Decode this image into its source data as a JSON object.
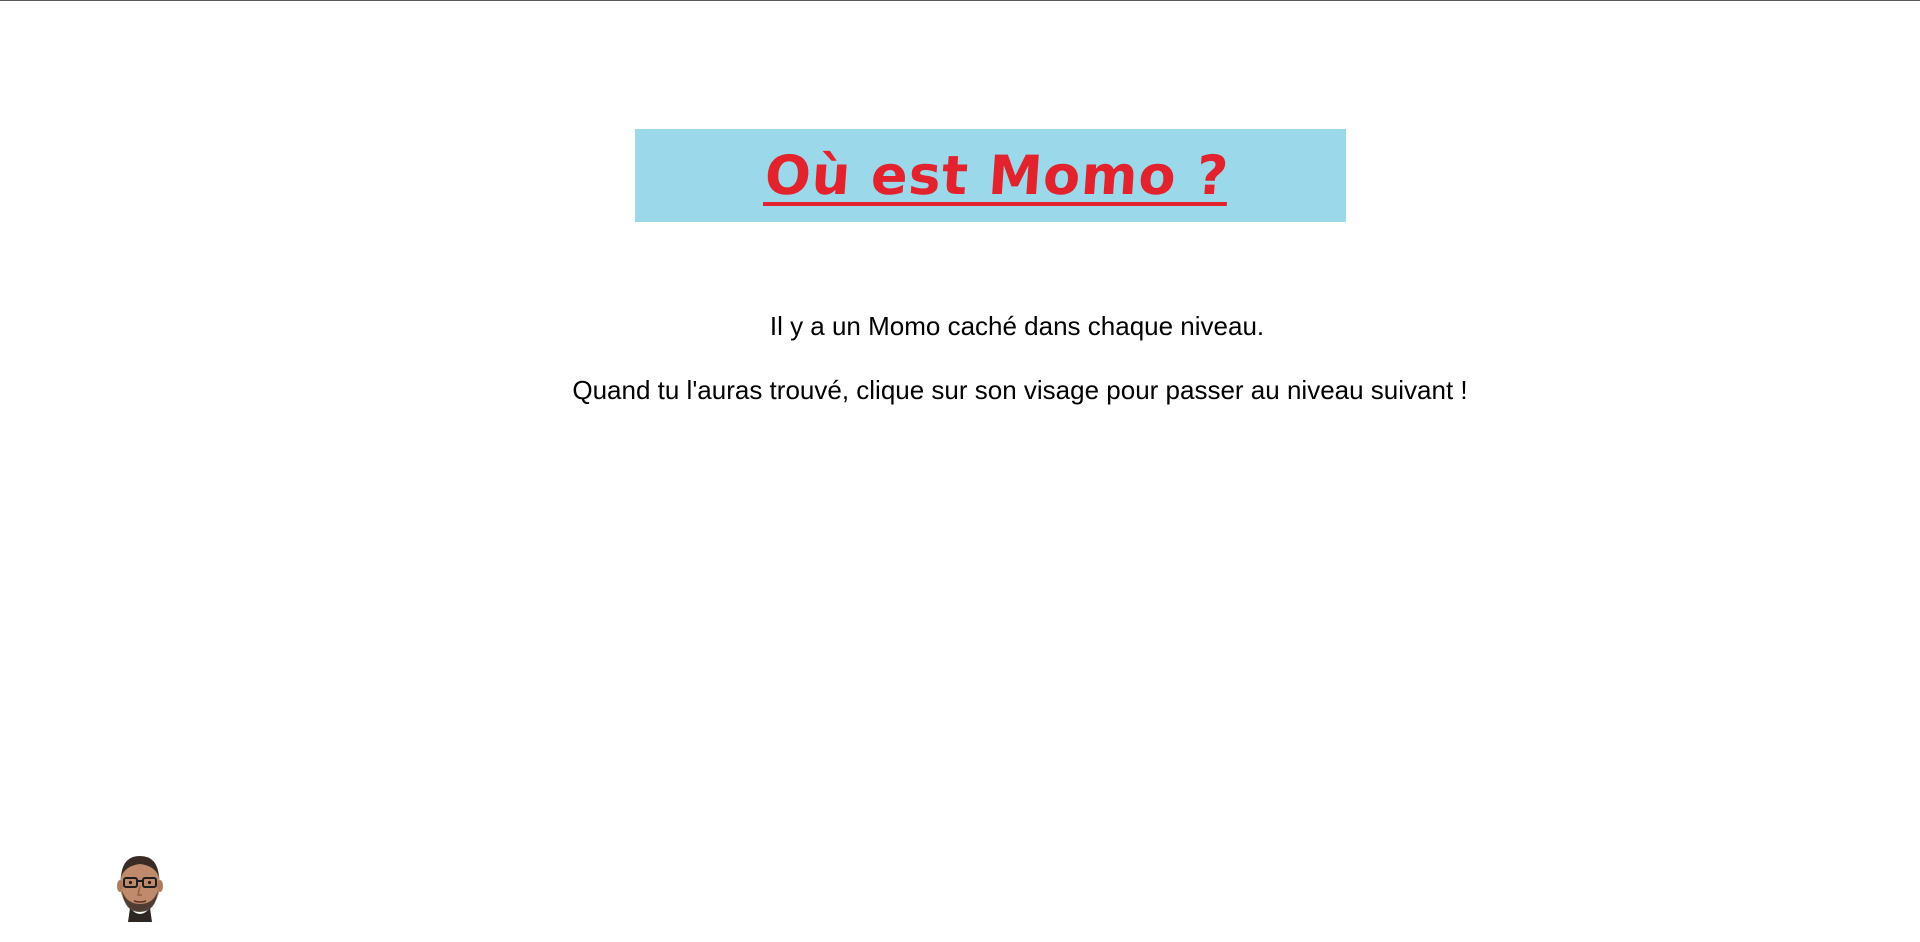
{
  "banner": {
    "title": "Où est Momo ?",
    "background_color": "#9ad8ea",
    "title_color": "#e2222c"
  },
  "instructions": {
    "line1": "Il y a un Momo caché dans chaque niveau.",
    "line2": "Quand tu l'auras trouvé, clique sur son visage pour passer au niveau suivant !"
  },
  "hidden_target": {
    "icon": "momo-face-icon"
  }
}
